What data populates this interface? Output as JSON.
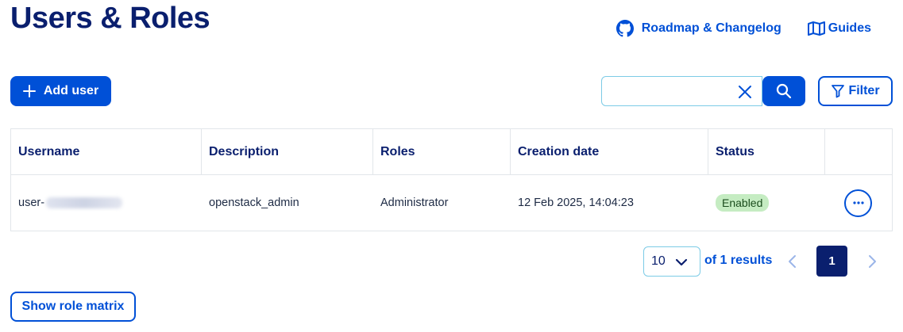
{
  "page": {
    "title": "Users & Roles"
  },
  "header_links": {
    "roadmap": {
      "label": "Roadmap & Changelog",
      "icon": "github-icon"
    },
    "guides": {
      "label": "Guides",
      "icon": "map-icon"
    }
  },
  "toolbar": {
    "add_user_label": "Add user",
    "search_value": "",
    "filter_label": "Filter"
  },
  "table": {
    "columns": [
      "Username",
      "Description",
      "Roles",
      "Creation date",
      "Status",
      ""
    ],
    "rows": [
      {
        "username_prefix": "user-",
        "description": "openstack_admin",
        "roles": "Administrator",
        "creation_date": "12 Feb 2025, 14:04:23",
        "status": "Enabled",
        "actions_label": "..."
      }
    ]
  },
  "pagination": {
    "page_size": "10",
    "results_text": "of 1 results",
    "current_page": "1"
  },
  "footer": {
    "role_matrix_label": "Show role matrix"
  },
  "colors": {
    "primary": "#0050d7",
    "heading": "#0a1f6e",
    "badge_bg": "#c5ecc2"
  }
}
